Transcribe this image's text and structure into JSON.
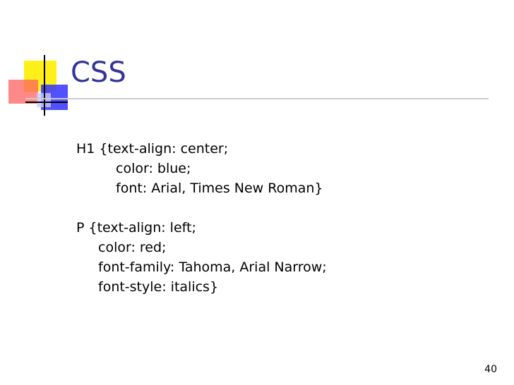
{
  "slide": {
    "title": "CSS",
    "page_number": "40",
    "colors": {
      "title": "#333399",
      "logo_yellow": "#ffee00",
      "logo_red": "#ff6060",
      "logo_blue": "#3333ff"
    },
    "code_lines": [
      "H1 {text-align: center;",
      "color: blue;",
      "font: Arial, Times New Roman}",
      "",
      "P {text-align: left;",
      "color: red;",
      "font-family: Tahoma, Arial Narrow;",
      "font-style: italics}"
    ]
  }
}
